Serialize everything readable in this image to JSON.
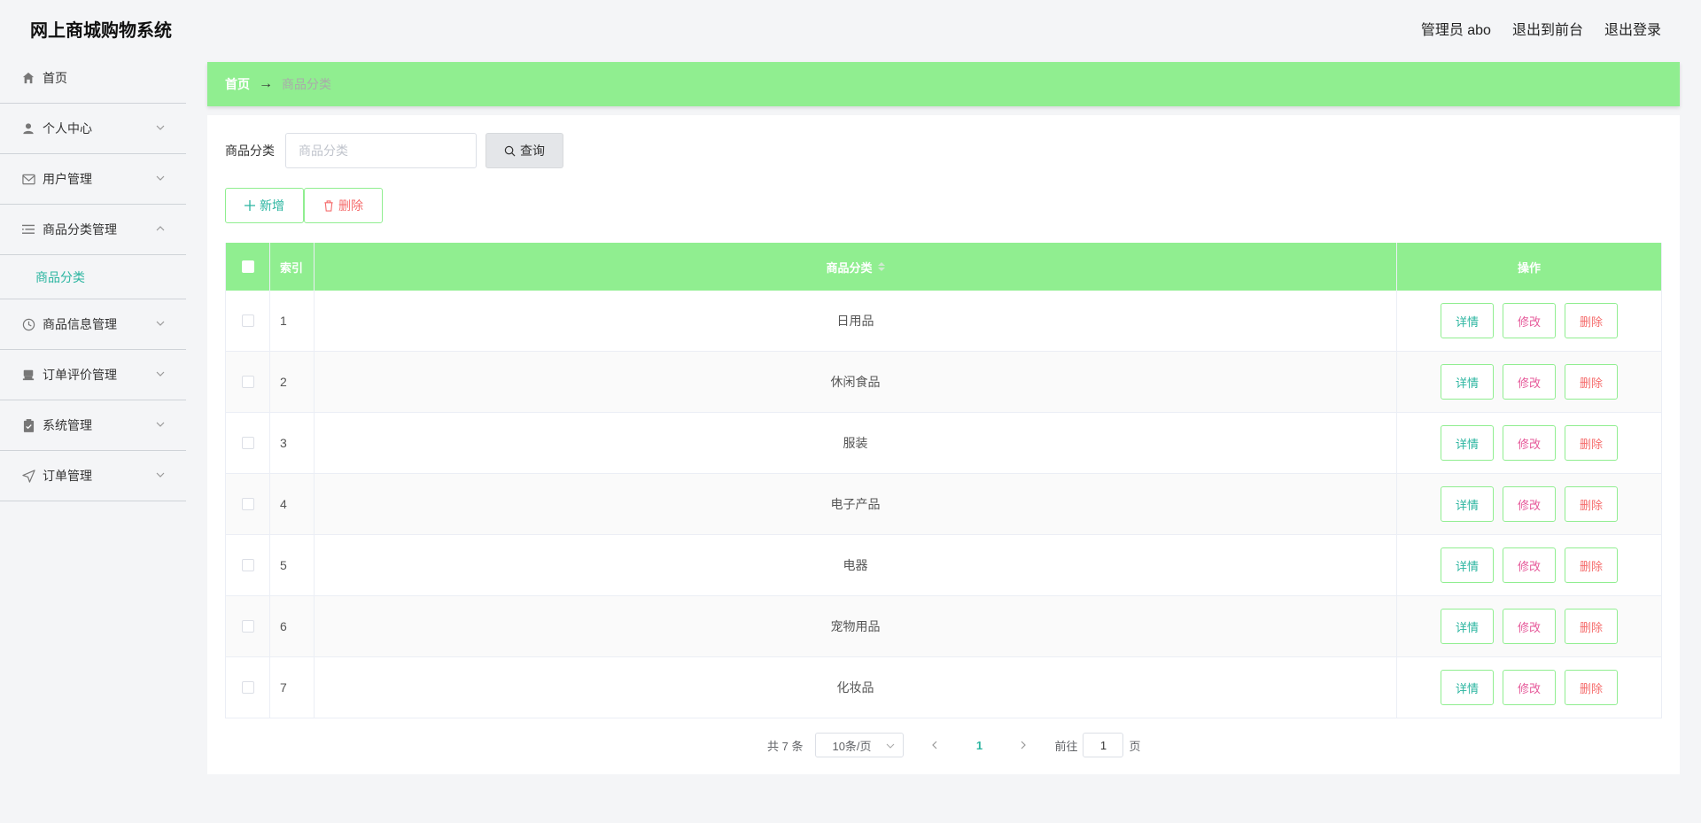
{
  "header": {
    "title": "网上商城购物系统",
    "user": "管理员 abo",
    "to_front": "退出到前台",
    "logout": "退出登录"
  },
  "sidebar": {
    "items": [
      {
        "label": "首页",
        "icon": "home-icon"
      },
      {
        "label": "个人中心",
        "icon": "user-icon"
      },
      {
        "label": "用户管理",
        "icon": "mail-icon"
      },
      {
        "label": "商品分类管理",
        "icon": "list-icon"
      },
      {
        "label": "商品信息管理",
        "icon": "clock-icon"
      },
      {
        "label": "订单评价管理",
        "icon": "shop-icon"
      },
      {
        "label": "系统管理",
        "icon": "clipboard-icon"
      },
      {
        "label": "订单管理",
        "icon": "send-icon"
      }
    ],
    "submenu_active": "商品分类"
  },
  "breadcrumb": {
    "home": "首页",
    "arrow": "→",
    "current": "商品分类"
  },
  "search": {
    "label": "商品分类",
    "placeholder": "商品分类",
    "button": "查询"
  },
  "actions": {
    "add": "新增",
    "delete": "删除"
  },
  "table": {
    "headers": {
      "index": "索引",
      "name": "商品分类",
      "ops": "操作"
    },
    "rows": [
      {
        "index": "1",
        "name": "日用品"
      },
      {
        "index": "2",
        "name": "休闲食品"
      },
      {
        "index": "3",
        "name": "服装"
      },
      {
        "index": "4",
        "name": "电子产品"
      },
      {
        "index": "5",
        "name": "电器"
      },
      {
        "index": "6",
        "name": "宠物用品"
      },
      {
        "index": "7",
        "name": "化妆品"
      }
    ],
    "op_labels": {
      "detail": "详情",
      "edit": "修改",
      "remove": "删除"
    }
  },
  "pagination": {
    "total": "共 7 条",
    "page_size": "10条/页",
    "current": "1",
    "goto_prefix": "前往",
    "goto_value": "1",
    "goto_suffix": "页"
  },
  "colors": {
    "accent_green": "#90ee90",
    "teal": "#2bb5a0",
    "danger": "#f56c6c",
    "pink": "#e65a9a"
  }
}
